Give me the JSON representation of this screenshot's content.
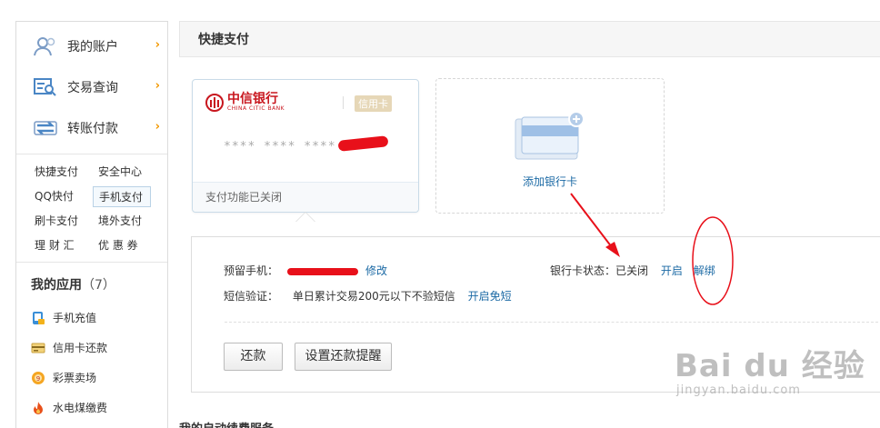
{
  "sidebar": {
    "nav": [
      {
        "label": "我的账户",
        "icon": "user-icon"
      },
      {
        "label": "交易查询",
        "icon": "search-list-icon"
      },
      {
        "label": "转账付款",
        "icon": "transfer-icon"
      }
    ],
    "links": [
      "快捷支付",
      "安全中心",
      "QQ快付",
      "手机支付",
      "刷卡支付",
      "境外支付",
      "理 财 汇",
      "优 惠 券"
    ],
    "active_link": "手机支付",
    "apps_title": "我的应用",
    "apps_count": "（7）",
    "apps": [
      {
        "label": "手机充值",
        "icon": "phone-recharge-icon"
      },
      {
        "label": "信用卡还款",
        "icon": "credit-card-repay-icon"
      },
      {
        "label": "彩票卖场",
        "icon": "lottery-icon"
      },
      {
        "label": "水电煤缴费",
        "icon": "utility-flame-icon"
      }
    ]
  },
  "main": {
    "title": "快捷支付",
    "card": {
      "bank_name": "中信银行",
      "bank_name_en": "CHINA CITIC BANK",
      "card_type": "信用卡",
      "masked_number": "**** **** ****",
      "status": "支付功能已关闭"
    },
    "add_card_label": "添加银行卡",
    "detail": {
      "phone_label": "预留手机：",
      "modify_link": "修改",
      "sms_label": "短信验证：",
      "sms_text": "单日累计交易200元以下不验短信",
      "sms_link": "开启免短",
      "card_status_label": "银行卡状态：",
      "card_status_value": "已关闭",
      "open_link": "开启",
      "unbind_link": "解绑",
      "repay_button": "还款",
      "reminder_button": "设置还款提醒"
    },
    "next_section": "我的自动续费服务"
  },
  "watermark": {
    "brand": "Bai du 经验",
    "url": "jingyan.baidu.com"
  },
  "colors": {
    "link": "#1c6aa5",
    "accent_orange": "#f39800",
    "annotation_red": "#e8101a"
  }
}
